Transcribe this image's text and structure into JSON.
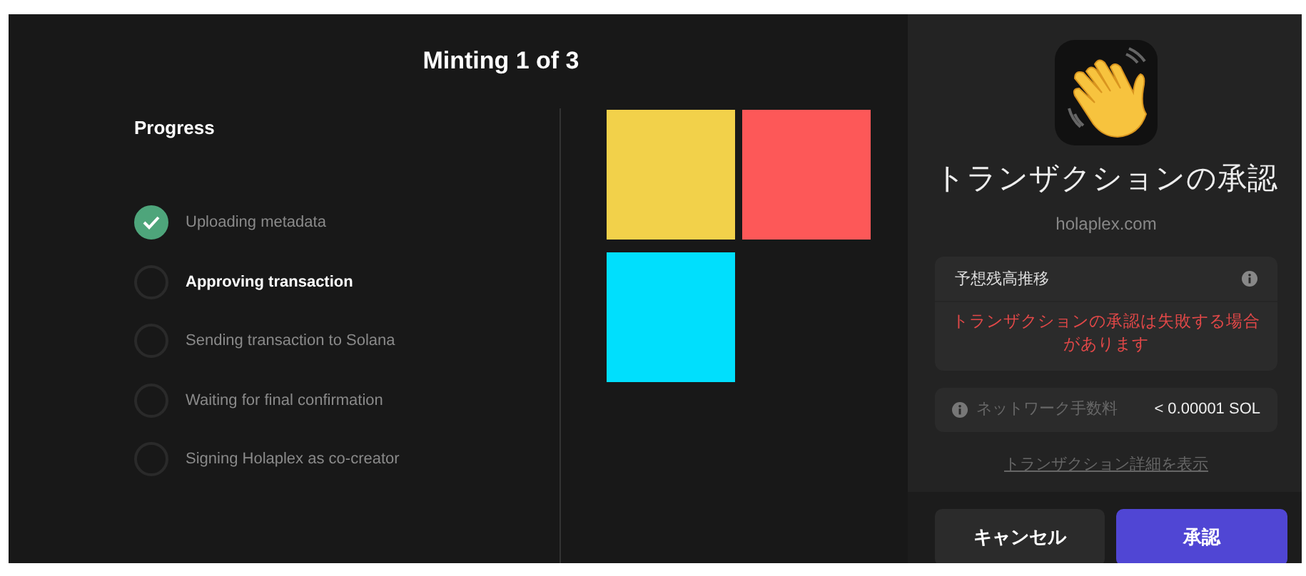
{
  "header": {
    "title": "Minting 1 of 3"
  },
  "progress": {
    "title": "Progress",
    "steps": [
      {
        "label": "Uploading metadata",
        "completed": true,
        "selected": false
      },
      {
        "label": "Approving transaction",
        "completed": false,
        "selected": true
      },
      {
        "label": "Sending transaction to Solana",
        "completed": false,
        "selected": false
      },
      {
        "label": "Waiting for final confirmation",
        "completed": false,
        "selected": false
      },
      {
        "label": "Signing Holaplex as co-creator",
        "completed": false,
        "selected": false
      }
    ]
  },
  "wallet": {
    "title": "トランザクションの承認",
    "origin": "holaplex.com",
    "balance": {
      "title": "予想残高推移",
      "error": "トランザクションの承認は失敗する場合があります"
    },
    "fee": {
      "label": "ネットワーク手数料",
      "value": "< 0.00001 SOL"
    },
    "details_link": "トランザクション詳細を表示",
    "buttons": [
      {
        "label": "キャンセル",
        "kind": "secondary"
      },
      {
        "label": "承認",
        "kind": "primary"
      }
    ]
  }
}
